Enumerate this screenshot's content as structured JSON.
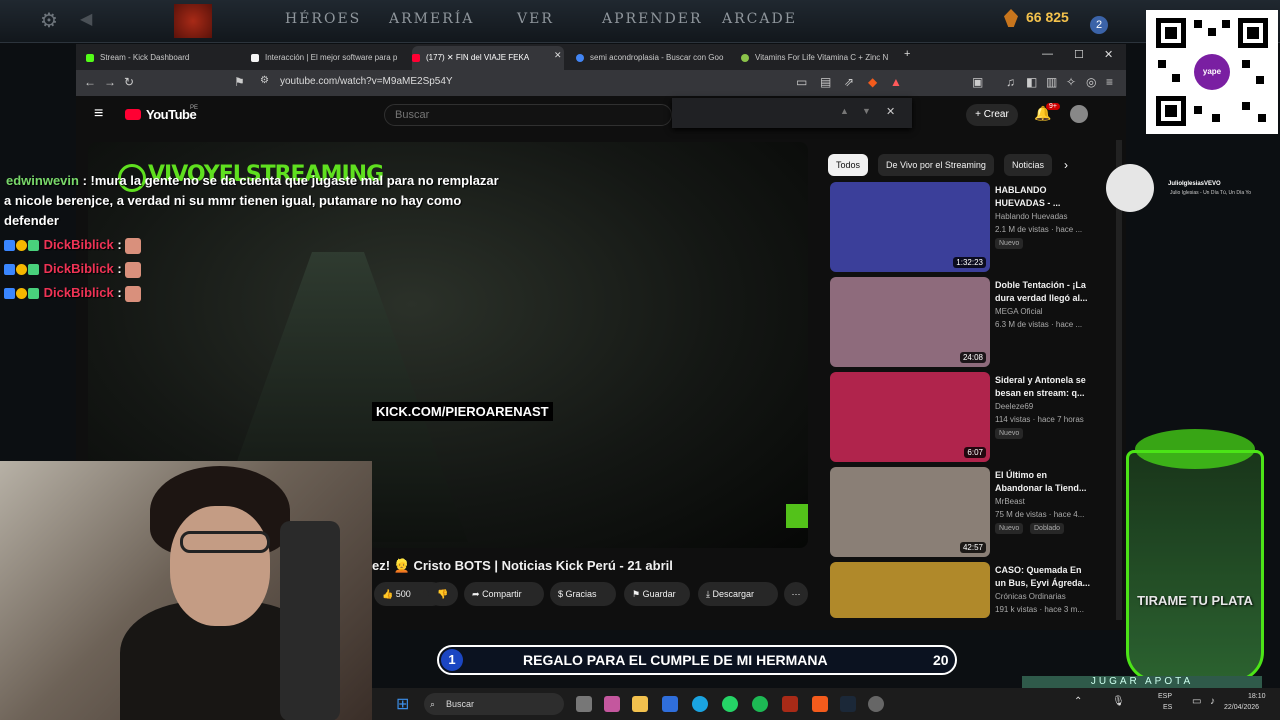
{
  "dota": {
    "nav": [
      "HÉROES",
      "ARMERÍA",
      "VER",
      "APRENDER",
      "ARCADE"
    ],
    "shards": "66 825",
    "notification_count": "2"
  },
  "browser": {
    "tabs": [
      {
        "label": "Stream - Kick Dashboard",
        "color": "#53fc18"
      },
      {
        "label": "Interacción | El mejor software para p",
        "color": "#f5f5f5"
      },
      {
        "label": "(177) ✕ FIN del VIAJE FEKA",
        "color": "#ff0033"
      },
      {
        "label": "semi acondroplasia - Buscar con Goo",
        "color": "#4285f4"
      },
      {
        "label": "Vitamins For Life Vitamina C + Zinc N",
        "color": "#8bc34a"
      }
    ],
    "url": "youtube.com/watch?v=M9aME2Sp54Y"
  },
  "youtube": {
    "logo": "YouTube",
    "region": "PE",
    "search_placeholder": "Buscar",
    "create_label": "Crear",
    "notification_badge": "9+",
    "video_overlay_text": "VIVOYELSTREAMING",
    "kick_url": "KICK.COM/PIEROARENAST",
    "title": "ez! 👱 Cristo BOTS | Noticias Kick Perú - 21 abril",
    "actions": {
      "likes": "500",
      "share": "Compartir",
      "thanks": "Gracias",
      "save": "Guardar",
      "download": "Descargar"
    },
    "chips": [
      "Todos",
      "De Vivo por el Streaming",
      "Noticias"
    ],
    "recommendations": [
      {
        "title": "HABLANDO HUEVADAS - ...",
        "channel": "Hablando Huevadas",
        "meta": "2.1 M de vistas · hace ...",
        "badge": "Nuevo",
        "badge2": "",
        "duration": "1:32:23",
        "thumb": "#3b3f9a"
      },
      {
        "title": "Doble Tentación - ¡La dura verdad llegó al...",
        "channel": "MEGA Oficial",
        "meta": "6.3 M de vistas · hace ...",
        "badge": "",
        "badge2": "",
        "duration": "24:08",
        "thumb": "#8e6b7c"
      },
      {
        "title": "Sideral y Antonela se besan en stream: q...",
        "channel": "Deeleze69",
        "meta": "114 vistas · hace 7 horas",
        "badge": "Nuevo",
        "badge2": "",
        "duration": "6:07",
        "thumb": "#b0244c"
      },
      {
        "title": "El Último en Abandonar la Tiend...",
        "channel": "MrBeast",
        "meta": "75 M de vistas · hace 4...",
        "badge": "Nuevo",
        "badge2": "Doblado",
        "duration": "42:57",
        "thumb": "#8a7f76"
      },
      {
        "title": "CASO: Quemada En un Bus, Eyvi Ágreda...",
        "channel": "Crónicas Ordinarias",
        "meta": "191 k vistas · hace 3 m...",
        "badge": "",
        "badge2": "",
        "duration": "",
        "thumb": "#b0892a"
      }
    ]
  },
  "chat": {
    "line1_user": "edwinwevin",
    "line1_text": ": !mura la gente no se da cuenta que jugaste mal para no remplazar",
    "line2_text": "a nicole berenjce, a verdad ni su mmr tienen igual, putamare no hay como",
    "line3_text": "defender",
    "repeat_user": "DickBiblick",
    "separator": ":"
  },
  "goal": {
    "number": "1",
    "text": "REGALO PARA EL CUMPLE DE MI HERMANA",
    "right": "20"
  },
  "taskbar": {
    "search": "Buscar",
    "lang1": "ESP",
    "lang2": "ES",
    "time": "18:10",
    "date": "22/04/2026"
  },
  "overlay": {
    "qr_label": "yape",
    "music_artist": "JulioIglesiasVEVO",
    "music_song": "Julio Iglesias - Un Día Tú, Un Día Yo",
    "cup_text": "TIRAME TU PLATA",
    "jugar": "JUGAR APOTA"
  }
}
